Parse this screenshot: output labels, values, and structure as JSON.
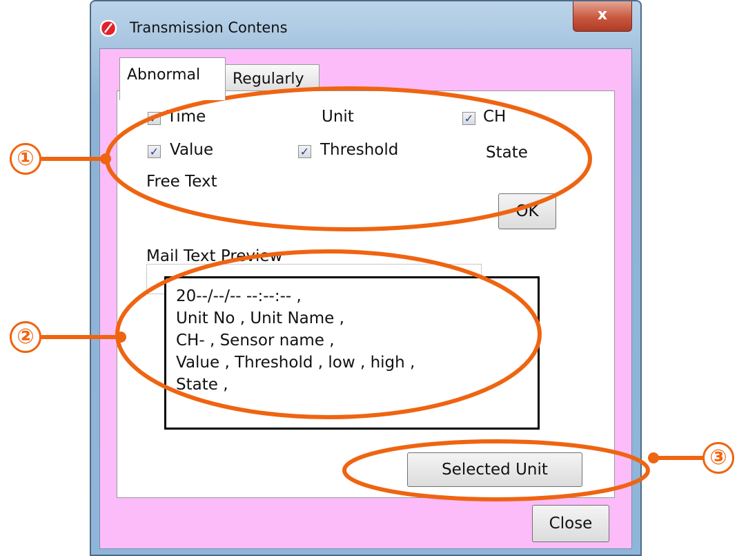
{
  "window": {
    "title": "Transmission Contens",
    "close_glyph": "x",
    "icon": "app-logo-icon"
  },
  "tabs": [
    {
      "label": "Abnormal",
      "active": true
    },
    {
      "label": "Regularly",
      "active": false
    }
  ],
  "fields": {
    "time": {
      "label": "Time",
      "checked": true
    },
    "unit": {
      "label": "Unit"
    },
    "ch": {
      "label": "CH",
      "checked": true
    },
    "value": {
      "label": "Value",
      "checked": true
    },
    "threshold": {
      "label": "Threshold",
      "checked": true
    },
    "state": {
      "label": "State"
    }
  },
  "free_text": {
    "label": "Free Text",
    "value": "",
    "ok_label": "OK"
  },
  "preview": {
    "label": "Mail Text Preview",
    "lines": [
      "20--/--/-- --:--:-- ,",
      "Unit No , Unit Name ,",
      "CH- , Sensor name ,",
      "Value , Threshold , low , high ,",
      "State ,"
    ]
  },
  "buttons": {
    "selected_unit": "Selected Unit",
    "close": "Close"
  },
  "callouts": [
    "①",
    "②",
    "③"
  ],
  "colors": {
    "client_background": "#fbbcf9",
    "annotation": "#ef6411",
    "checkmark": "#2a3f8f"
  }
}
